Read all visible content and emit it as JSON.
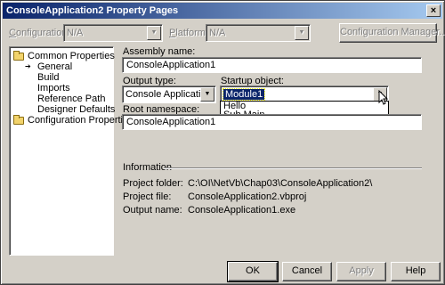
{
  "window": {
    "title": "ConsoleApplication2 Property Pages",
    "close_glyph": "×"
  },
  "top_bar": {
    "configuration_label": "Configuration:",
    "configuration_value": "N/A",
    "platform_label": "Platform:",
    "platform_value": "N/A",
    "config_manager_button": "Configuration Manager..."
  },
  "tree": {
    "common_properties": "Common Properties",
    "children": [
      "General",
      "Build",
      "Imports",
      "Reference Path",
      "Designer Defaults"
    ],
    "configuration_properties": "Configuration Properties"
  },
  "form": {
    "assembly_name_label": "Assembly name:",
    "assembly_name_value": "ConsoleApplication1",
    "output_type_label": "Output type:",
    "output_type_value": "Console Application",
    "startup_object_label": "Startup object:",
    "startup_object_value": "Module1",
    "startup_options": [
      "Hello",
      "Sub Main"
    ],
    "root_namespace_label": "Root namespace:",
    "root_namespace_value": "ConsoleApplication1"
  },
  "info": {
    "heading": "Information",
    "project_folder_label": "Project folder:",
    "project_folder_value": "C:\\OI\\NetVb\\Chap03\\ConsoleApplication2\\",
    "project_file_label": "Project file:",
    "project_file_value": "ConsoleApplication2.vbproj",
    "output_name_label": "Output name:",
    "output_name_value": "ConsoleApplication1.exe"
  },
  "buttons": {
    "ok": "OK",
    "cancel": "Cancel",
    "apply": "Apply",
    "help": "Help"
  },
  "colors": {
    "titlebar_start": "#0a246a",
    "titlebar_end": "#a6caf0",
    "face": "#d4d0c8",
    "selection": "#0a246a"
  }
}
